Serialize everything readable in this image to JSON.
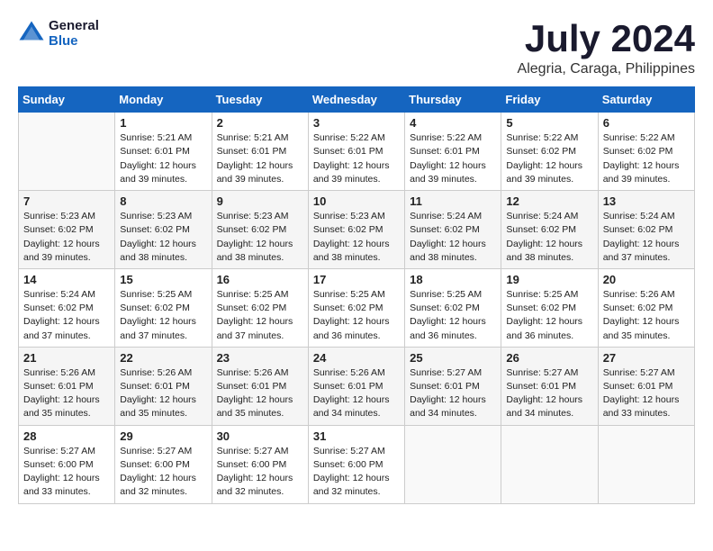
{
  "header": {
    "logo_line1": "General",
    "logo_line2": "Blue",
    "month": "July 2024",
    "location": "Alegria, Caraga, Philippines"
  },
  "weekdays": [
    "Sunday",
    "Monday",
    "Tuesday",
    "Wednesday",
    "Thursday",
    "Friday",
    "Saturday"
  ],
  "weeks": [
    [
      {
        "day": "",
        "info": ""
      },
      {
        "day": "1",
        "info": "Sunrise: 5:21 AM\nSunset: 6:01 PM\nDaylight: 12 hours\nand 39 minutes."
      },
      {
        "day": "2",
        "info": "Sunrise: 5:21 AM\nSunset: 6:01 PM\nDaylight: 12 hours\nand 39 minutes."
      },
      {
        "day": "3",
        "info": "Sunrise: 5:22 AM\nSunset: 6:01 PM\nDaylight: 12 hours\nand 39 minutes."
      },
      {
        "day": "4",
        "info": "Sunrise: 5:22 AM\nSunset: 6:01 PM\nDaylight: 12 hours\nand 39 minutes."
      },
      {
        "day": "5",
        "info": "Sunrise: 5:22 AM\nSunset: 6:02 PM\nDaylight: 12 hours\nand 39 minutes."
      },
      {
        "day": "6",
        "info": "Sunrise: 5:22 AM\nSunset: 6:02 PM\nDaylight: 12 hours\nand 39 minutes."
      }
    ],
    [
      {
        "day": "7",
        "info": "Sunrise: 5:23 AM\nSunset: 6:02 PM\nDaylight: 12 hours\nand 39 minutes."
      },
      {
        "day": "8",
        "info": "Sunrise: 5:23 AM\nSunset: 6:02 PM\nDaylight: 12 hours\nand 38 minutes."
      },
      {
        "day": "9",
        "info": "Sunrise: 5:23 AM\nSunset: 6:02 PM\nDaylight: 12 hours\nand 38 minutes."
      },
      {
        "day": "10",
        "info": "Sunrise: 5:23 AM\nSunset: 6:02 PM\nDaylight: 12 hours\nand 38 minutes."
      },
      {
        "day": "11",
        "info": "Sunrise: 5:24 AM\nSunset: 6:02 PM\nDaylight: 12 hours\nand 38 minutes."
      },
      {
        "day": "12",
        "info": "Sunrise: 5:24 AM\nSunset: 6:02 PM\nDaylight: 12 hours\nand 38 minutes."
      },
      {
        "day": "13",
        "info": "Sunrise: 5:24 AM\nSunset: 6:02 PM\nDaylight: 12 hours\nand 37 minutes."
      }
    ],
    [
      {
        "day": "14",
        "info": "Sunrise: 5:24 AM\nSunset: 6:02 PM\nDaylight: 12 hours\nand 37 minutes."
      },
      {
        "day": "15",
        "info": "Sunrise: 5:25 AM\nSunset: 6:02 PM\nDaylight: 12 hours\nand 37 minutes."
      },
      {
        "day": "16",
        "info": "Sunrise: 5:25 AM\nSunset: 6:02 PM\nDaylight: 12 hours\nand 37 minutes."
      },
      {
        "day": "17",
        "info": "Sunrise: 5:25 AM\nSunset: 6:02 PM\nDaylight: 12 hours\nand 36 minutes."
      },
      {
        "day": "18",
        "info": "Sunrise: 5:25 AM\nSunset: 6:02 PM\nDaylight: 12 hours\nand 36 minutes."
      },
      {
        "day": "19",
        "info": "Sunrise: 5:25 AM\nSunset: 6:02 PM\nDaylight: 12 hours\nand 36 minutes."
      },
      {
        "day": "20",
        "info": "Sunrise: 5:26 AM\nSunset: 6:02 PM\nDaylight: 12 hours\nand 35 minutes."
      }
    ],
    [
      {
        "day": "21",
        "info": "Sunrise: 5:26 AM\nSunset: 6:01 PM\nDaylight: 12 hours\nand 35 minutes."
      },
      {
        "day": "22",
        "info": "Sunrise: 5:26 AM\nSunset: 6:01 PM\nDaylight: 12 hours\nand 35 minutes."
      },
      {
        "day": "23",
        "info": "Sunrise: 5:26 AM\nSunset: 6:01 PM\nDaylight: 12 hours\nand 35 minutes."
      },
      {
        "day": "24",
        "info": "Sunrise: 5:26 AM\nSunset: 6:01 PM\nDaylight: 12 hours\nand 34 minutes."
      },
      {
        "day": "25",
        "info": "Sunrise: 5:27 AM\nSunset: 6:01 PM\nDaylight: 12 hours\nand 34 minutes."
      },
      {
        "day": "26",
        "info": "Sunrise: 5:27 AM\nSunset: 6:01 PM\nDaylight: 12 hours\nand 34 minutes."
      },
      {
        "day": "27",
        "info": "Sunrise: 5:27 AM\nSunset: 6:01 PM\nDaylight: 12 hours\nand 33 minutes."
      }
    ],
    [
      {
        "day": "28",
        "info": "Sunrise: 5:27 AM\nSunset: 6:00 PM\nDaylight: 12 hours\nand 33 minutes."
      },
      {
        "day": "29",
        "info": "Sunrise: 5:27 AM\nSunset: 6:00 PM\nDaylight: 12 hours\nand 32 minutes."
      },
      {
        "day": "30",
        "info": "Sunrise: 5:27 AM\nSunset: 6:00 PM\nDaylight: 12 hours\nand 32 minutes."
      },
      {
        "day": "31",
        "info": "Sunrise: 5:27 AM\nSunset: 6:00 PM\nDaylight: 12 hours\nand 32 minutes."
      },
      {
        "day": "",
        "info": ""
      },
      {
        "day": "",
        "info": ""
      },
      {
        "day": "",
        "info": ""
      }
    ]
  ]
}
